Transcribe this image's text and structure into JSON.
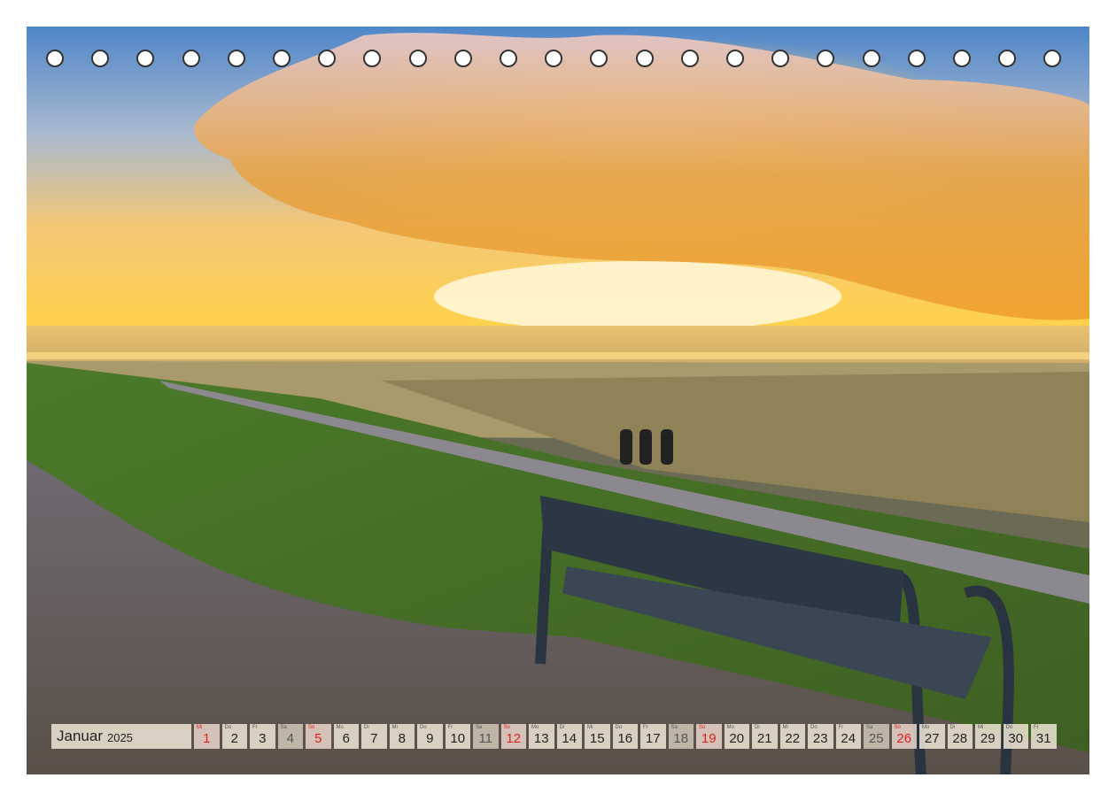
{
  "calendar": {
    "month": "Januar",
    "year": "2025",
    "days": [
      {
        "n": "1",
        "wd": "Mi",
        "type": "sun"
      },
      {
        "n": "2",
        "wd": "Do",
        "type": "wk"
      },
      {
        "n": "3",
        "wd": "Fr",
        "type": "wk"
      },
      {
        "n": "4",
        "wd": "Sa",
        "type": "sat"
      },
      {
        "n": "5",
        "wd": "So",
        "type": "sun"
      },
      {
        "n": "6",
        "wd": "Mo",
        "type": "wk"
      },
      {
        "n": "7",
        "wd": "Di",
        "type": "wk"
      },
      {
        "n": "8",
        "wd": "Mi",
        "type": "wk"
      },
      {
        "n": "9",
        "wd": "Do",
        "type": "wk"
      },
      {
        "n": "10",
        "wd": "Fr",
        "type": "wk"
      },
      {
        "n": "11",
        "wd": "Sa",
        "type": "sat"
      },
      {
        "n": "12",
        "wd": "So",
        "type": "sun"
      },
      {
        "n": "13",
        "wd": "Mo",
        "type": "wk"
      },
      {
        "n": "14",
        "wd": "Di",
        "type": "wk"
      },
      {
        "n": "15",
        "wd": "Mi",
        "type": "wk"
      },
      {
        "n": "16",
        "wd": "Do",
        "type": "wk"
      },
      {
        "n": "17",
        "wd": "Fr",
        "type": "wk"
      },
      {
        "n": "18",
        "wd": "Sa",
        "type": "sat"
      },
      {
        "n": "19",
        "wd": "So",
        "type": "sun"
      },
      {
        "n": "20",
        "wd": "Mo",
        "type": "wk"
      },
      {
        "n": "21",
        "wd": "Di",
        "type": "wk"
      },
      {
        "n": "22",
        "wd": "Mi",
        "type": "wk"
      },
      {
        "n": "23",
        "wd": "Do",
        "type": "wk"
      },
      {
        "n": "24",
        "wd": "Fr",
        "type": "wk"
      },
      {
        "n": "25",
        "wd": "Sa",
        "type": "sat"
      },
      {
        "n": "26",
        "wd": "So",
        "type": "sun"
      },
      {
        "n": "27",
        "wd": "Mo",
        "type": "wk"
      },
      {
        "n": "28",
        "wd": "Di",
        "type": "wk"
      },
      {
        "n": "29",
        "wd": "Mi",
        "type": "wk"
      },
      {
        "n": "30",
        "wd": "Do",
        "type": "wk"
      },
      {
        "n": "31",
        "wd": "Fr",
        "type": "wk"
      }
    ]
  },
  "colors": {
    "holiday_red": "#e02020",
    "sky_gold": "#f7c744",
    "grass": "#5f7a2e"
  }
}
